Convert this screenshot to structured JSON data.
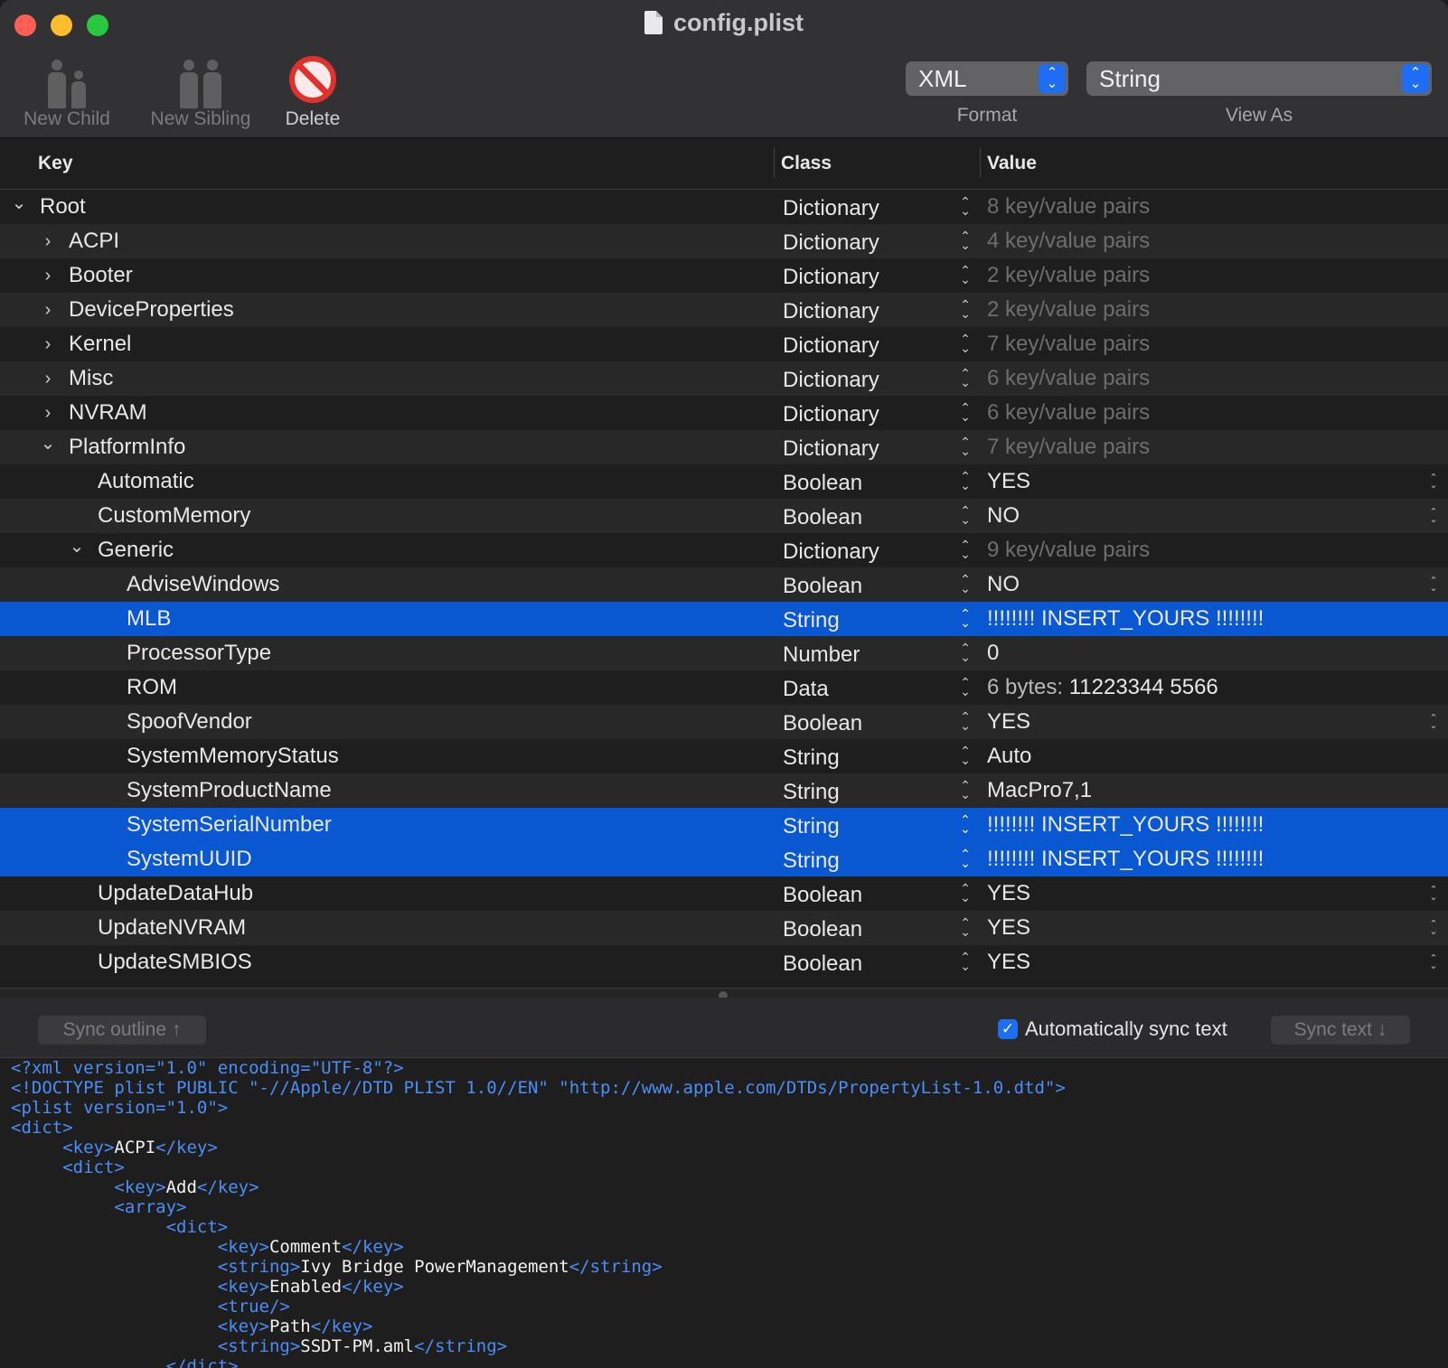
{
  "window": {
    "title": "config.plist"
  },
  "toolbar": {
    "new_child": "New Child",
    "new_sibling": "New Sibling",
    "delete": "Delete",
    "format_value": "XML",
    "format_label": "Format",
    "view_as_value": "String",
    "view_as_label": "View As"
  },
  "columns": {
    "key": "Key",
    "class": "Class",
    "value": "Value"
  },
  "rows": [
    {
      "key": "Root",
      "level": 0,
      "disclosure": "open",
      "class": "Dictionary",
      "value": "8 key/value pairs",
      "muted": true
    },
    {
      "key": "ACPI",
      "level": 1,
      "disclosure": "closed",
      "class": "Dictionary",
      "value": "4 key/value pairs",
      "muted": true
    },
    {
      "key": "Booter",
      "level": 1,
      "disclosure": "closed",
      "class": "Dictionary",
      "value": "2 key/value pairs",
      "muted": true
    },
    {
      "key": "DeviceProperties",
      "level": 1,
      "disclosure": "closed",
      "class": "Dictionary",
      "value": "2 key/value pairs",
      "muted": true
    },
    {
      "key": "Kernel",
      "level": 1,
      "disclosure": "closed",
      "class": "Dictionary",
      "value": "7 key/value pairs",
      "muted": true
    },
    {
      "key": "Misc",
      "level": 1,
      "disclosure": "closed",
      "class": "Dictionary",
      "value": "6 key/value pairs",
      "muted": true
    },
    {
      "key": "NVRAM",
      "level": 1,
      "disclosure": "closed",
      "class": "Dictionary",
      "value": "6 key/value pairs",
      "muted": true
    },
    {
      "key": "PlatformInfo",
      "level": 1,
      "disclosure": "open",
      "class": "Dictionary",
      "value": "7 key/value pairs",
      "muted": true
    },
    {
      "key": "Automatic",
      "level": 2,
      "class": "Boolean",
      "value": "YES",
      "bool": true
    },
    {
      "key": "CustomMemory",
      "level": 2,
      "class": "Boolean",
      "value": "NO",
      "bool": true
    },
    {
      "key": "Generic",
      "level": 2,
      "disclosure": "open",
      "class": "Dictionary",
      "value": "9 key/value pairs",
      "muted": true
    },
    {
      "key": "AdviseWindows",
      "level": 3,
      "class": "Boolean",
      "value": "NO",
      "bool": true
    },
    {
      "key": "MLB",
      "level": 3,
      "class": "String",
      "value": "!!!!!!!! INSERT_YOURS !!!!!!!!",
      "selected": true
    },
    {
      "key": "ProcessorType",
      "level": 3,
      "class": "Number",
      "value": "0"
    },
    {
      "key": "ROM",
      "level": 3,
      "class": "Data",
      "value_prefix": "6 bytes: ",
      "value": "11223344 5566"
    },
    {
      "key": "SpoofVendor",
      "level": 3,
      "class": "Boolean",
      "value": "YES",
      "bool": true
    },
    {
      "key": "SystemMemoryStatus",
      "level": 3,
      "class": "String",
      "value": "Auto"
    },
    {
      "key": "SystemProductName",
      "level": 3,
      "class": "String",
      "value": "MacPro7,1"
    },
    {
      "key": "SystemSerialNumber",
      "level": 3,
      "class": "String",
      "value": "!!!!!!!! INSERT_YOURS !!!!!!!!",
      "selected": true
    },
    {
      "key": "SystemUUID",
      "level": 3,
      "class": "String",
      "value": "!!!!!!!! INSERT_YOURS !!!!!!!!",
      "selected": true
    },
    {
      "key": "UpdateDataHub",
      "level": 2,
      "class": "Boolean",
      "value": "YES",
      "bool": true
    },
    {
      "key": "UpdateNVRAM",
      "level": 2,
      "class": "Boolean",
      "value": "YES",
      "bool": true
    },
    {
      "key": "UpdateSMBIOS",
      "level": 2,
      "class": "Boolean",
      "value": "YES",
      "bool": true
    }
  ],
  "sync": {
    "sync_outline": "Sync outline ↑",
    "auto_sync_label": "Automatically sync text",
    "auto_sync_checked": true,
    "sync_text": "Sync text ↓"
  },
  "xml_lines": [
    {
      "indent": 0,
      "parts": [
        [
          "tag",
          "<?xml version=\"1.0\" encoding=\"UTF-8\"?>"
        ]
      ]
    },
    {
      "indent": 0,
      "parts": [
        [
          "tag",
          "<!DOCTYPE plist PUBLIC \"-//Apple//DTD PLIST 1.0//EN\" \"http://www.apple.com/DTDs/PropertyList-1.0.dtd\">"
        ]
      ]
    },
    {
      "indent": 0,
      "parts": [
        [
          "tag",
          "<plist version=\"1.0\">"
        ]
      ]
    },
    {
      "indent": 0,
      "parts": [
        [
          "tag",
          "<dict>"
        ]
      ]
    },
    {
      "indent": 1,
      "parts": [
        [
          "tag",
          "<key>"
        ],
        [
          "txt",
          "ACPI"
        ],
        [
          "tag",
          "</key>"
        ]
      ]
    },
    {
      "indent": 1,
      "parts": [
        [
          "tag",
          "<dict>"
        ]
      ]
    },
    {
      "indent": 2,
      "parts": [
        [
          "tag",
          "<key>"
        ],
        [
          "txt",
          "Add"
        ],
        [
          "tag",
          "</key>"
        ]
      ]
    },
    {
      "indent": 2,
      "parts": [
        [
          "tag",
          "<array>"
        ]
      ]
    },
    {
      "indent": 3,
      "parts": [
        [
          "tag",
          "<dict>"
        ]
      ]
    },
    {
      "indent": 4,
      "parts": [
        [
          "tag",
          "<key>"
        ],
        [
          "txt",
          "Comment"
        ],
        [
          "tag",
          "</key>"
        ]
      ]
    },
    {
      "indent": 4,
      "parts": [
        [
          "tag",
          "<string>"
        ],
        [
          "txt",
          "Ivy Bridge PowerManagement"
        ],
        [
          "tag",
          "</string>"
        ]
      ]
    },
    {
      "indent": 4,
      "parts": [
        [
          "tag",
          "<key>"
        ],
        [
          "txt",
          "Enabled"
        ],
        [
          "tag",
          "</key>"
        ]
      ]
    },
    {
      "indent": 4,
      "parts": [
        [
          "tag",
          "<true/>"
        ]
      ]
    },
    {
      "indent": 4,
      "parts": [
        [
          "tag",
          "<key>"
        ],
        [
          "txt",
          "Path"
        ],
        [
          "tag",
          "</key>"
        ]
      ]
    },
    {
      "indent": 4,
      "parts": [
        [
          "tag",
          "<string>"
        ],
        [
          "txt",
          "SSDT-PM.aml"
        ],
        [
          "tag",
          "</string>"
        ]
      ]
    },
    {
      "indent": 3,
      "parts": [
        [
          "tag",
          "</dict>"
        ]
      ]
    }
  ]
}
